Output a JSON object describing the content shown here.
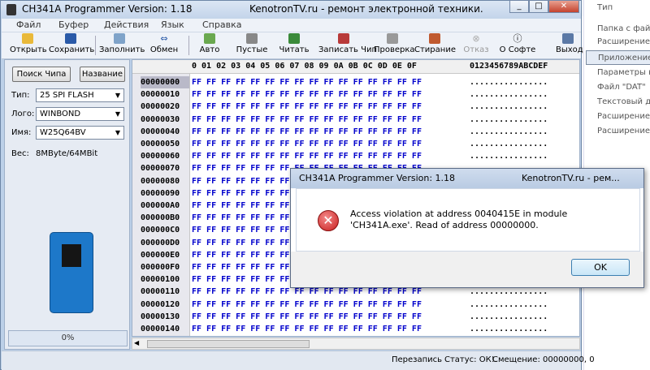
{
  "right_panel": {
    "items": [
      "Тип",
      "Папка с файл",
      "Расширение ф",
      "Приложение",
      "Параметры ко",
      "Файл \"DAT\"",
      "Текстовый до",
      "Расширение ф",
      "Расширение ф"
    ]
  },
  "app": {
    "title": "CH341A Programmer Version: 1.18",
    "title2": "KenotronTV.ru - ремонт электронной техники.",
    "window_min": "_",
    "window_max": "□",
    "window_close": "✕"
  },
  "menu": [
    "Файл",
    "Буфер",
    "Действия",
    "Язык",
    "Справка"
  ],
  "toolbar": {
    "open": "Открыть",
    "save": "Сохранить",
    "fill": "Заполнить",
    "exchange": "Обмен",
    "auto": "Авто",
    "blank": "Пустые",
    "read": "Читать",
    "write": "Записать Чип",
    "verify": "Проверка",
    "erase": "Стирание",
    "cancel": "Отказ",
    "about": "О Софте",
    "exit": "Выход"
  },
  "left": {
    "search_btn": "Поиск Чипа",
    "name_btn": "Название",
    "type_label": "Тип:",
    "type_value": "25 SPI FLASH",
    "vendor_label": "Лого:",
    "vendor_value": "WINBOND",
    "name_label": "Имя:",
    "name_value": "W25Q64BV",
    "size_label": "Вес:",
    "size_value": "8MByte/64MBit",
    "progress_text": "0%",
    "progress_value": 0
  },
  "hex": {
    "header_bytes": "0 01 02 03 04 05 06 07 08 09 0A 0B 0C 0D 0E 0F",
    "header_ascii": "0123456789ABCDEF",
    "rows": [
      "00000000",
      "00000010",
      "00000020",
      "00000030",
      "00000040",
      "00000050",
      "00000060",
      "00000070",
      "00000080",
      "00000090",
      "000000A0",
      "000000B0",
      "000000C0",
      "000000D0",
      "000000E0",
      "000000F0",
      "00000100",
      "00000110",
      "00000120",
      "00000130",
      "00000140"
    ],
    "bytes": "FF FF FF FF FF FF FF FF FF FF FF FF FF FF FF FF",
    "ascii": "................"
  },
  "status": {
    "mode": "Перезапись",
    "state": "Статус: ОК!.",
    "offset": "Смещение: 00000000, 0"
  },
  "dialog": {
    "title": "CH341A Programmer Version: 1.18",
    "title2": "KenotronTV.ru - рем...",
    "message": "Access violation at address 0040415E in module 'CH341A.exe'. Read of address 00000000.",
    "ok": "OK",
    "close": "✕",
    "error_glyph": "✕"
  },
  "colors": {
    "hex_bytes": "#0000cc",
    "window_frame": "#bcd0e8",
    "chip_board": "#1d78c9"
  }
}
